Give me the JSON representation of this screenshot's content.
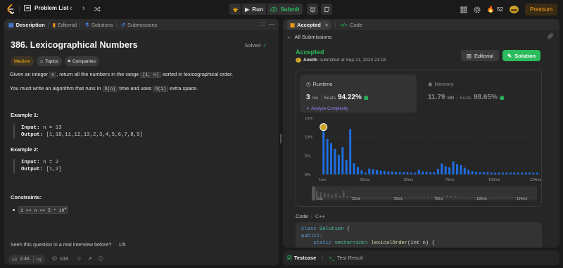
{
  "topbar": {
    "problem_list": "Problem List",
    "run": "Run",
    "submit": "Submit",
    "streak": "52",
    "premium": "Premium"
  },
  "left": {
    "tabs": [
      "Description",
      "Editorial",
      "Solutions",
      "Submissions"
    ],
    "title": "386. Lexicographical Numbers",
    "solved": "Solved",
    "chips": [
      "Medium",
      "Topics",
      "Companies"
    ],
    "desc1_pre": "Given an integer",
    "desc1_n": "n",
    "desc1_mid": ", return all the numbers in the range",
    "desc1_range": "[1, n]",
    "desc1_post": "sorted in lexicographical order.",
    "desc2_pre": "You must write an algorithm that runs in",
    "desc2_on": "O(n)",
    "desc2_mid": "time and uses",
    "desc2_o1": "O(1)",
    "desc2_post": "extra space.",
    "ex1_title": "Example 1:",
    "ex1_input_label": "Input:",
    "ex1_input": "n = 13",
    "ex1_output_label": "Output:",
    "ex1_output": "[1,10,11,12,13,2,3,4,5,6,7,8,9]",
    "ex2_title": "Example 2:",
    "ex2_input_label": "Input:",
    "ex2_input": "n = 2",
    "ex2_output_label": "Output:",
    "ex2_output": "[1,2]",
    "constraints_title": "Constraints:",
    "constraint_main": "1 <= n <= 5 * 10",
    "constraint_exp": "4",
    "interview_q": "Seen this question in a real interview before?",
    "interview_page": "1/5",
    "likes": "2.4K",
    "comments": "103"
  },
  "right": {
    "tab_accepted": "Accepted",
    "tab_code": "Code",
    "all_submissions": "All Submissions",
    "status": "Accepted",
    "author": "Ankith",
    "submitted_at": "submitted at Sep 21, 2024 21:18",
    "editorial_btn": "Editorial",
    "solution_btn": "Solution",
    "runtime_label": "Runtime",
    "runtime_value": "3",
    "runtime_unit": "ms",
    "beats_label": "Beats",
    "runtime_beats": "94.22%",
    "analyze": "Analyze Complexity",
    "memory_label": "Memory",
    "memory_value": "11.79",
    "memory_unit": "MB",
    "memory_beats": "98.65%",
    "code_label": "Code",
    "code_lang": "C++",
    "code_lines": [
      [
        "kw",
        "class "
      ],
      [
        "ty",
        "Solution "
      ],
      [
        "",
        "{"
      ]
    ],
    "code_line1_kw": "class",
    "code_line1_name": "Solution",
    "code_line1_end": "{",
    "code_line2": "public:",
    "code_line3_kw": "static",
    "code_line3_type": "vector<int>",
    "code_line3_fn": "lexicalOrder",
    "code_line3_args": "(int n) {"
  },
  "bottom": {
    "testcase": "Testcase",
    "test_result": "Test Result"
  },
  "colors": {
    "accent_green": "#2cbb5d",
    "bar_blue": "#1e6fe0",
    "brand_orange": "#ffa116"
  },
  "chart_data": {
    "type": "bar",
    "yticks": [
      "15%",
      "10%",
      "5%",
      "0%"
    ],
    "ylim": [
      0,
      15
    ],
    "xticks": [
      "1ms",
      "25ms",
      "50ms",
      "75ms",
      "100ms",
      "124ms"
    ],
    "minimap_ticks": [
      "25ms",
      "50ms",
      "75ms",
      "100ms",
      "124ms"
    ],
    "highlight_index": 0,
    "values": [
      11.5,
      9.5,
      8.4,
      6.8,
      5.2,
      7.3,
      3.9,
      12.1,
      3.0,
      2.0,
      1.1,
      0.5,
      1.6,
      1.4,
      1.2,
      1.0,
      0.9,
      0.8,
      0.8,
      0.7,
      0.6,
      0.6,
      0.6,
      0.5,
      0.5,
      1.2,
      0.8,
      0.7,
      0.6,
      0.6,
      1.5,
      2.9,
      2.2,
      1.9,
      3.5,
      2.8,
      2.5,
      1.8,
      1.2,
      0.9,
      0.7,
      0.6,
      0.6,
      0.6,
      0.5,
      0.5,
      0.5,
      0.5,
      0.5,
      0.5,
      0.5,
      0.5,
      0.5,
      0.5,
      0.5,
      0.5,
      0.5
    ]
  }
}
